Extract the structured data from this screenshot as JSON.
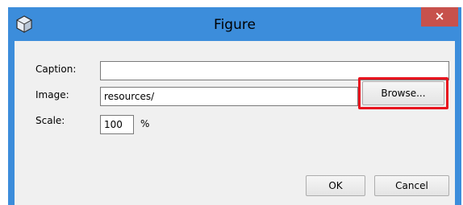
{
  "window": {
    "title": "Figure",
    "close_glyph": "×"
  },
  "form": {
    "caption_label": "Caption:",
    "caption_value": "",
    "image_label": "Image:",
    "image_value": "resources/",
    "browse_label": "Browse...",
    "scale_label": "Scale:",
    "scale_value": "100",
    "scale_unit": "%"
  },
  "buttons": {
    "ok": "OK",
    "cancel": "Cancel"
  },
  "colors": {
    "titlebar": "#3c8ddb",
    "close": "#c7514c",
    "highlight": "#e8141e"
  },
  "icons": [
    "app-icon",
    "close-icon"
  ]
}
